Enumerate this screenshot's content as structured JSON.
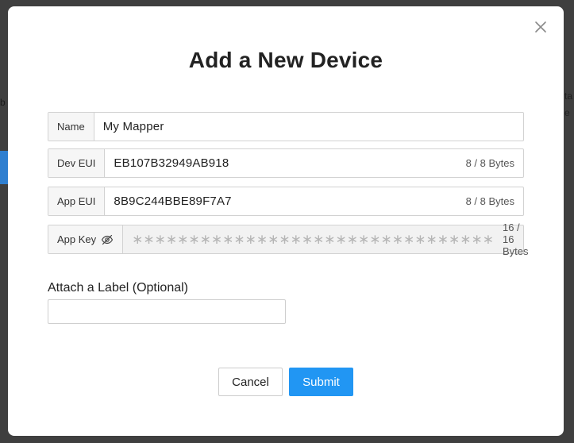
{
  "modal": {
    "title": "Add a New Device",
    "fields": [
      {
        "label": "Name",
        "value": "My Mapper",
        "bytes": ""
      },
      {
        "label": "Dev EUI",
        "value": "EB107B32949AB918",
        "bytes": "8 / 8 Bytes"
      },
      {
        "label": "App EUI",
        "value": "8B9C244BBE89F7A7",
        "bytes": "8 / 8 Bytes"
      },
      {
        "label": "App Key",
        "value": "∗∗∗∗∗∗∗∗∗∗∗∗∗∗∗∗∗∗∗∗∗∗∗∗∗∗∗∗∗∗∗∗",
        "bytes": "16 / 16 Bytes"
      }
    ],
    "label_section": {
      "title": "Attach a Label (Optional)",
      "value": "",
      "placeholder": ""
    },
    "buttons": {
      "cancel": "Cancel",
      "submit": "Submit"
    },
    "icons": {
      "close": "close-icon",
      "eye": "eye-slash-icon"
    }
  },
  "background": {
    "left_fragment": "b",
    "right_fragment_1": "ta",
    "right_fragment_2": "e"
  },
  "colors": {
    "accent": "#2196f3",
    "backdrop": "#3f3f3f"
  }
}
